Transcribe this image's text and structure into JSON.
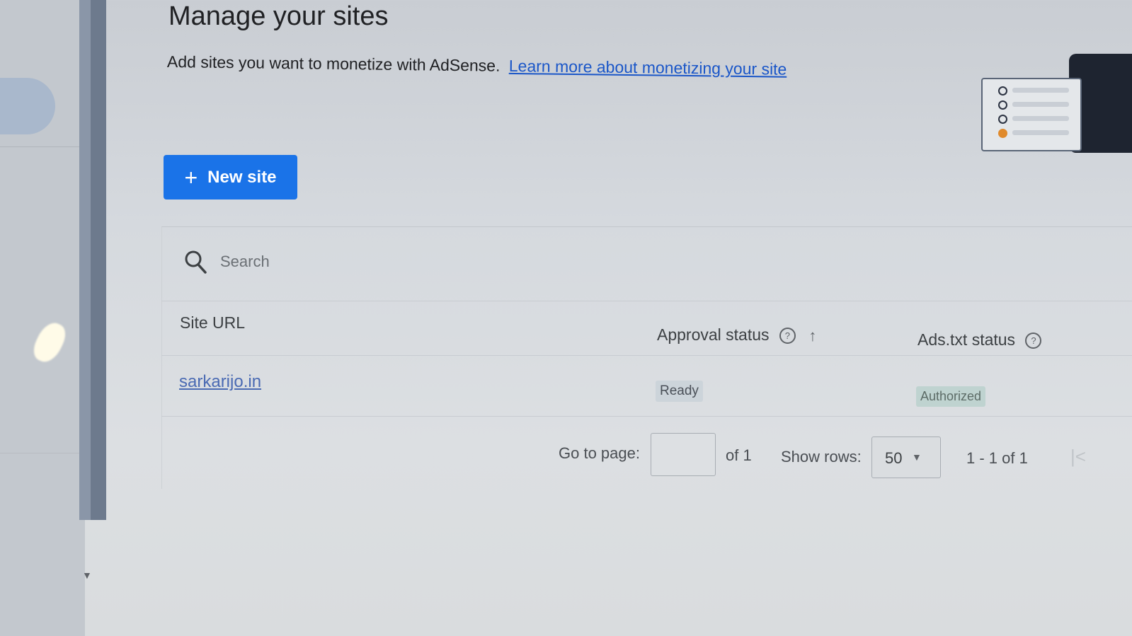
{
  "header": {
    "title": "Manage your sites",
    "subtitle": "Add sites you want to monetize with AdSense.",
    "learn_more_link": "Learn more about monetizing your site"
  },
  "actions": {
    "new_site_label": "New site"
  },
  "search": {
    "placeholder": "Search"
  },
  "table": {
    "columns": {
      "site_url": "Site URL",
      "approval_status": "Approval status",
      "ads_txt_status": "Ads.txt status"
    },
    "rows": [
      {
        "site_url": "sarkarijo.in",
        "approval_status": "Ready",
        "ads_txt_status": "Authorized"
      }
    ]
  },
  "pagination": {
    "go_to_page_label": "Go to page:",
    "of_pages": "of 1",
    "show_rows_label": "Show rows:",
    "rows_per_page": "50",
    "range": "1 - 1 of 1"
  },
  "colors": {
    "primary_button": "#1a73e8",
    "link": "#1a56c8",
    "ready_chip": "#ccd4da",
    "authorized_chip": "#bfd3d0"
  },
  "icons": [
    "plus-icon",
    "search-icon",
    "help-icon",
    "sort-arrow-icon",
    "chevron-down-icon",
    "first-page-icon"
  ]
}
